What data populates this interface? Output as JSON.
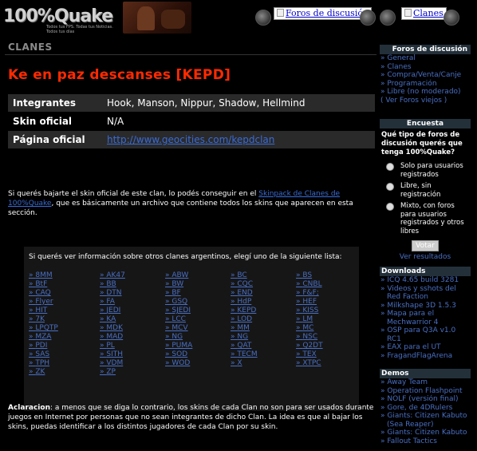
{
  "header": {
    "logo_text": "100%Quake",
    "logo_tagline": "Todos tus FPS. Todas tus Noticias. Todos tus días",
    "foros_button": "Foros de discusión",
    "clanes_button": "Clanes"
  },
  "main": {
    "section_label": "CLANES",
    "title": "Ke en paz descanses [KEPD]",
    "info": [
      {
        "label": "Integrantes",
        "value": "Hook, Manson, Nippur, Shadow, Hellmind"
      },
      {
        "label": "Skin oficial",
        "value": "N/A"
      },
      {
        "label": "Página oficial",
        "value": "http://www.geocities.com/kepdclan"
      }
    ],
    "para1_before": "Si querés bajarte el skin oficial de este clan, lo podés conseguir en el ",
    "para1_link": "Skinpack de Clanes de 100%Quake",
    "para1_after": ", que es básicamente un archivo que contiene todos los skins que aparecen en esta sección.",
    "clan_intro": "Si querés ver información sobre otros clanes argentinos, elegí uno de la siguiente lista:",
    "clans": [
      "8MM",
      "AK47",
      "ABW",
      "BC",
      "BS",
      "BtF",
      "BB",
      "BW",
      "CQC",
      "CNBL",
      "CAQ",
      "DTN",
      "BF",
      "END",
      "F&F;",
      "Flyer",
      "FA",
      "GSQ",
      "HdP",
      "HEF",
      "HIT",
      "JEDI",
      "SJEDI",
      "KEPD",
      "KISS",
      "7K",
      "KA",
      "LCC",
      "LOD",
      "LM",
      "LPQTP",
      "MDK",
      "MCV",
      "MM",
      "MC",
      "MZA",
      "MAD",
      "NG",
      "NG",
      "NSC",
      "PDI",
      "PL",
      "PUMA",
      "QAT",
      "Q2DT",
      "SAS",
      "SITH",
      "SOD",
      "TECM",
      "TEX",
      "TPH",
      "VDM",
      "WOD",
      "X",
      "XTPC",
      "ZK",
      "ZP"
    ],
    "para2_bold": "Aclaracion",
    "para2_text": ": a menos que se diga lo contrario, los skins de cada Clan no son para ser usados durante juegos en Internet por personas que no sean integrantes de dicho Clan. La idea es que al bajar los skins, puedas identificar a los distintos jugadores de cada Clan por su skin."
  },
  "sidebar": {
    "foros_title": "Foros de discusión",
    "foros_links": [
      "General",
      "Clanes",
      "Compra/Venta/Canje",
      "Programación",
      "Libre (no moderado)"
    ],
    "foros_all": "( Ver Foros viejos )",
    "encuesta_title": "Encuesta",
    "poll_question": "Qué tipo de foros de discusión querés que tenga 100%Quake?",
    "poll_options": [
      "Solo para usuarios registrados",
      "Libre, sin registración",
      "Mixto, con foros para usuarios registrados y otros libres"
    ],
    "vote_label": "Votar",
    "results_label": "Ver resultados",
    "downloads_title": "Downloads",
    "downloads": [
      {
        "text": "ICQ 4.65 build 3281",
        "indent": false
      },
      {
        "text": "Videos y sshots del",
        "indent": false
      },
      {
        "text": "Red Faction",
        "indent": true
      },
      {
        "text": "Milkshape 3D 1.5.3",
        "indent": false
      },
      {
        "text": "Mapa para el",
        "indent": false
      },
      {
        "text": "Mechwarrior 4",
        "indent": true
      },
      {
        "text": "OSP para Q3A v1.0",
        "indent": false
      },
      {
        "text": "RC1",
        "indent": true
      },
      {
        "text": "EAX para el UT",
        "indent": false
      },
      {
        "text": "FragandFlagArena",
        "indent": false
      }
    ],
    "demos_title": "Demos",
    "demos": [
      {
        "text": "Away Team",
        "indent": false
      },
      {
        "text": "Operation Flashpoint",
        "indent": false
      },
      {
        "text": "NOLF (versión final)",
        "indent": false
      },
      {
        "text": "Gore, de 4DRulers",
        "indent": false
      },
      {
        "text": "Giants: Citizen Kabuto",
        "indent": false
      },
      {
        "text": "(Sea Reaper)",
        "indent": true
      },
      {
        "text": "Giants: Citizen Kabuto",
        "indent": false
      },
      {
        "text": "Fallout Tactics",
        "indent": false
      }
    ]
  }
}
